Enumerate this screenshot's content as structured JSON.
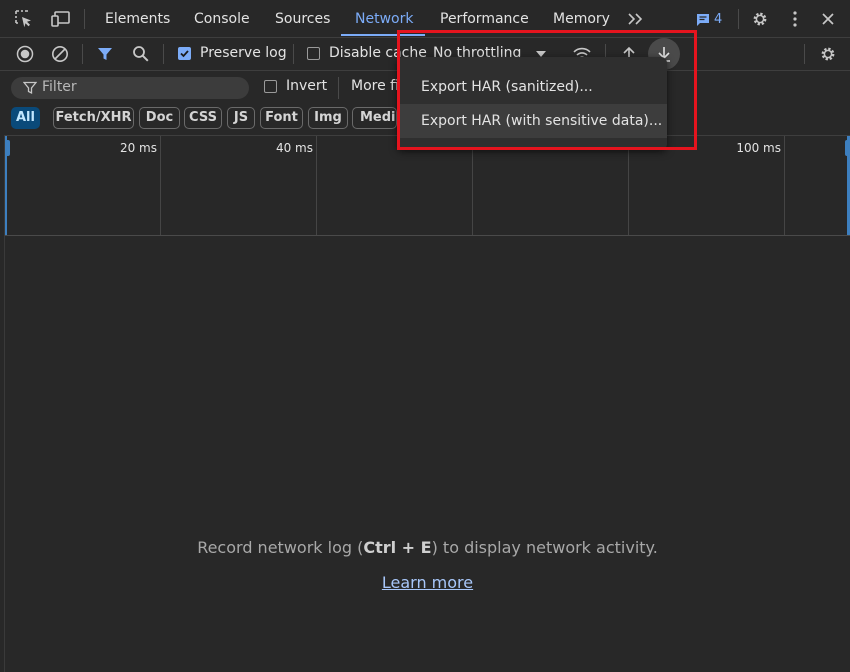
{
  "tabs": [
    {
      "label": "Elements",
      "active": false
    },
    {
      "label": "Console",
      "active": false
    },
    {
      "label": "Sources",
      "active": false
    },
    {
      "label": "Network",
      "active": true
    },
    {
      "label": "Performance",
      "active": false
    },
    {
      "label": "Memory",
      "active": false
    }
  ],
  "issues_count": "4",
  "toolbar": {
    "preserve_log_label": "Preserve log",
    "preserve_log_checked": true,
    "disable_cache_label": "Disable cache",
    "disable_cache_checked": false,
    "throttling_value": "No throttling"
  },
  "filter": {
    "placeholder": "Filter",
    "invert_label": "Invert",
    "more_filters_label": "More filters"
  },
  "type_chips": [
    {
      "label": "All",
      "active": true
    },
    {
      "label": "Fetch/XHR",
      "active": false
    },
    {
      "label": "Doc",
      "active": false
    },
    {
      "label": "CSS",
      "active": false
    },
    {
      "label": "JS",
      "active": false
    },
    {
      "label": "Font",
      "active": false
    },
    {
      "label": "Img",
      "active": false
    },
    {
      "label": "Media",
      "active": false
    }
  ],
  "timeline_ticks": [
    "20 ms",
    "40 ms",
    "100 ms"
  ],
  "export_menu": {
    "items": [
      {
        "label": "Export HAR (sanitized)...",
        "highlighted": false
      },
      {
        "label": "Export HAR (with sensitive data)...",
        "highlighted": true
      }
    ]
  },
  "empty_state": {
    "text_before": "Record network log (",
    "shortcut": "Ctrl + E",
    "text_after": ") to display network activity.",
    "link_label": "Learn more"
  },
  "colors": {
    "background": "#282828",
    "accent": "#7cacf8",
    "highlight_box": "#e5141e"
  }
}
